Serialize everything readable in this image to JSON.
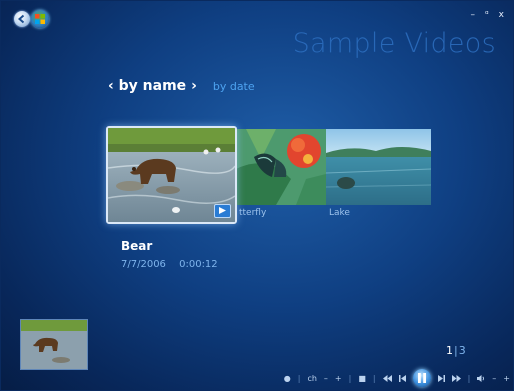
{
  "window": {
    "controls": {
      "minimize": "–",
      "restore": "ᵅ",
      "close": "x"
    }
  },
  "nav": {
    "back_icon": "back-arrow-icon",
    "start_icon": "windows-orb-icon"
  },
  "header": {
    "title": "Sample Videos"
  },
  "sort": {
    "prev_arrow": "‹",
    "active": "by name",
    "next_arrow": "›",
    "inactive": "by date"
  },
  "gallery": {
    "items": [
      {
        "label": "Bear",
        "selected": true
      },
      {
        "label": "Butterfly",
        "visible_label": "tterfly"
      },
      {
        "label": "Lake"
      }
    ]
  },
  "details": {
    "title": "Bear",
    "date": "7/7/2006",
    "duration": "0:00:12"
  },
  "pager": {
    "current": "1",
    "separator": "|",
    "total": "3"
  },
  "transport": {
    "record": "●",
    "channel_label": "ch",
    "channel_down": "–",
    "channel_up": "+",
    "stop": "■",
    "divider": "|",
    "volume_down": "–",
    "volume_up": "+"
  },
  "colors": {
    "background": "#0f3f82",
    "title": "#2d6fc0",
    "accent": "#4ea3f0",
    "meta": "#7fb4ec"
  }
}
